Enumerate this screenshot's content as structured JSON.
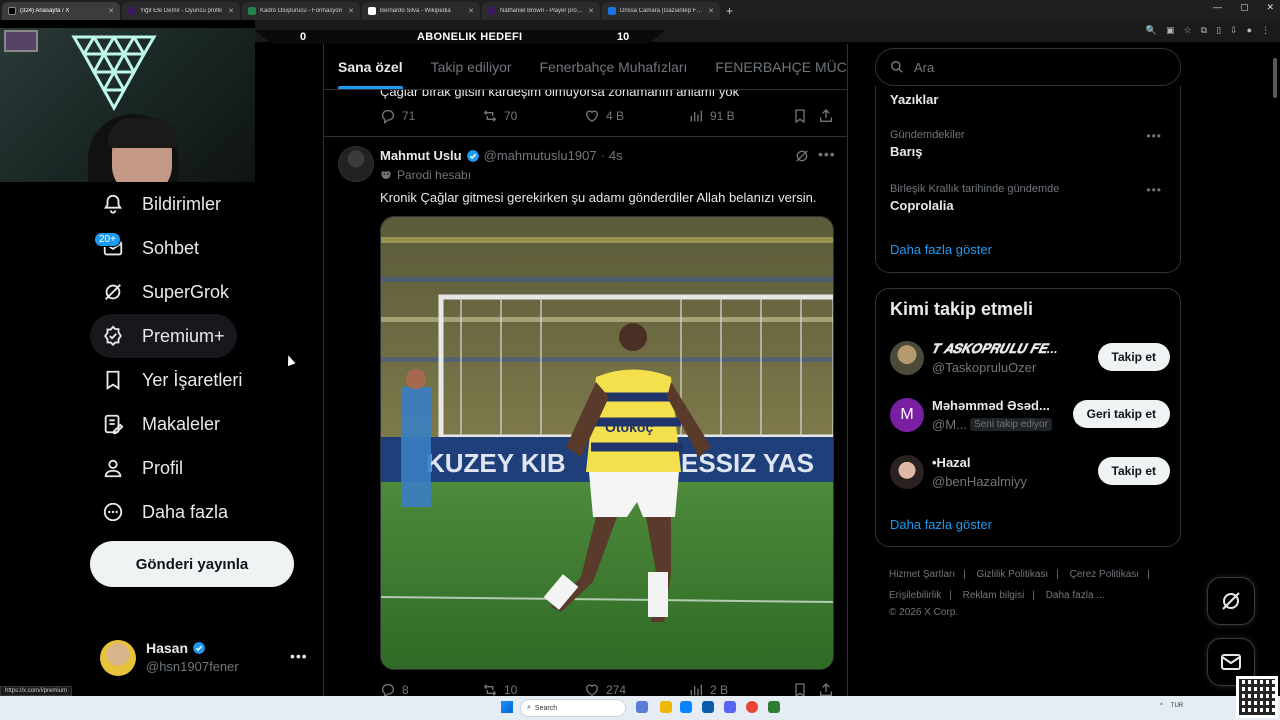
{
  "browser": {
    "tabs": [
      {
        "label": "(324) Anasayfa / X",
        "color": "#000000",
        "active": true
      },
      {
        "label": "Yiğit Efe Demir - Oyuncu profili",
        "color": "#3d195b",
        "active": false
      },
      {
        "label": "Kadro Oluşturucu - Formasyon",
        "color": "#1e8449",
        "active": false
      },
      {
        "label": "Bernardo Silva - Wikipedia",
        "color": "#ffffff",
        "active": false
      },
      {
        "label": "Nathaniel Brown - Player profile",
        "color": "#3d195b",
        "active": false
      },
      {
        "label": "Drissa Camara (Gaziantep FK) ...",
        "color": "#1a73e8",
        "active": false
      }
    ],
    "new_tab": "+",
    "status_url": "https://x.com/i/premium"
  },
  "overlay": {
    "goal_left": "0",
    "goal_title": "ABONELIK HEDEFI",
    "goal_right": "10"
  },
  "nav": {
    "items": [
      {
        "label": "Bildirimler",
        "icon": "bell-icon"
      },
      {
        "label": "Sohbet",
        "icon": "mail-icon",
        "badge": "20+"
      },
      {
        "label": "SuperGrok",
        "icon": "grok-icon"
      },
      {
        "label": "Premium+",
        "icon": "premium-icon"
      },
      {
        "label": "Yer İşaretleri",
        "icon": "bookmark-icon"
      },
      {
        "label": "Makaleler",
        "icon": "article-icon"
      },
      {
        "label": "Profil",
        "icon": "person-icon"
      },
      {
        "label": "Daha fazla",
        "icon": "more-circle-icon"
      }
    ],
    "post_button": "Gönderi yayınla",
    "account": {
      "name": "Hasan",
      "handle": "@hsn1907fener",
      "more": "•••"
    }
  },
  "feed": {
    "tabs": [
      "Sana özel",
      "Takip ediliyor",
      "Fenerbahçe Muhafızları",
      "FENERBAHÇE MÜCADE"
    ],
    "prev_tweet": {
      "text_fragment": "Çağlar bırak gitsin kardeşim olmuyorsa zonamanın anlamı yok",
      "replies": "71",
      "reposts": "70",
      "likes": "4 B",
      "views": "91 B"
    },
    "tweet": {
      "name": "Mahmut Uslu",
      "handle": "@mahmutuslu1907",
      "dot": "·",
      "time": "4s",
      "label": "Parodi hesabı",
      "text": "Kronik Çağlar gitmesi gerekirken şu adamı gönderdiler Allah belanızı versin.",
      "more": "•••",
      "replies": "8",
      "reposts": "10",
      "likes": "274",
      "views": "2 B"
    }
  },
  "right": {
    "search_placeholder": "Ara",
    "trends": {
      "title": "Yazıklar",
      "items": [
        {
          "context": "Gündemdekiler",
          "name": "Barış"
        },
        {
          "context": "Birleşik Krallık tarihinde gündemde",
          "name": "Coprolalia"
        }
      ],
      "show_more": "Daha fazla göster"
    },
    "who_to_follow": {
      "title": "Kimi takip etmeli",
      "items": [
        {
          "name": "𝑻 𝑨𝑺𝑲𝑶𝑷𝑹𝑼𝑳𝑼 𝑭𝑬...",
          "handle": "@TaskopruluOzer",
          "button": "Takip et"
        },
        {
          "name": "Məhəmməd Əsəd...",
          "handle": "@M...",
          "tag": "Seni takip ediyor",
          "button": "Geri takip et",
          "avatar_letter": "M"
        },
        {
          "name": "•Hazal",
          "handle": "@benHazalmiyy",
          "button": "Takip et"
        }
      ],
      "show_more": "Daha fazla göster"
    },
    "footer": {
      "line1": [
        "Hizmet Şartları",
        "Gizlilik Politikası",
        "Çerez Politikası"
      ],
      "line2": [
        "Erişilebilirlik",
        "Reklam bilgisi",
        "Daha fazla ..."
      ],
      "copyright": "© 2026 X Corp.",
      "pipe": "|"
    }
  },
  "taskbar": {
    "search_label": "Search",
    "lang": "TUR"
  },
  "colors": {
    "accent": "#1d9bf0",
    "bg": "#000000",
    "border": "#2f3336",
    "muted": "#71767b"
  }
}
